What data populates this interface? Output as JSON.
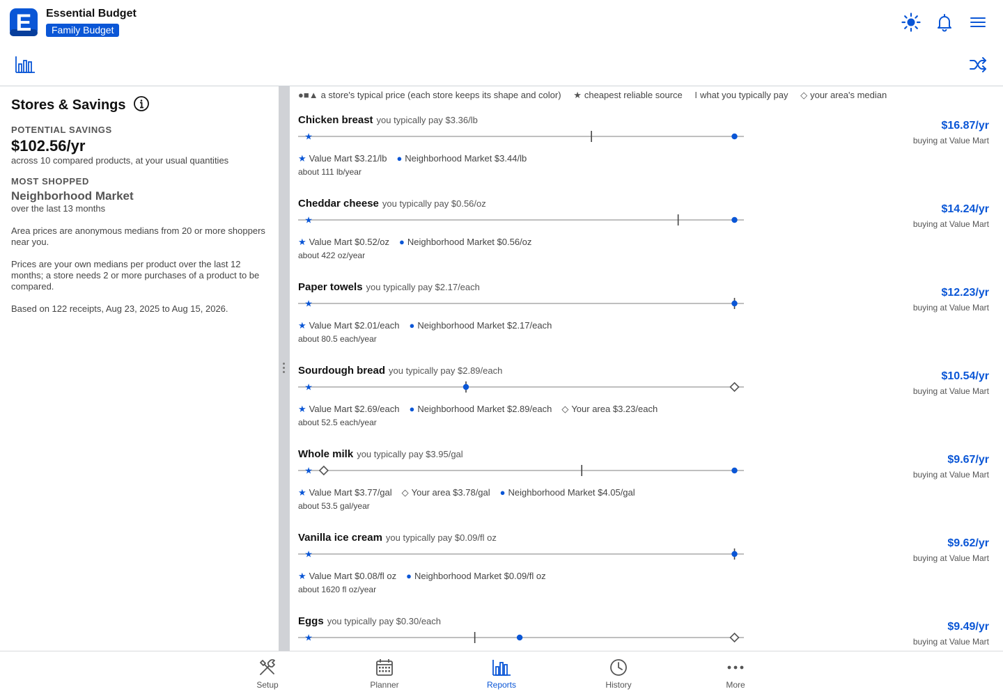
{
  "header": {
    "app_title": "Essential Budget",
    "budget_name": "Family Budget",
    "accent_color": "#0a56d6"
  },
  "left_panel": {
    "title": "Stores & Savings",
    "potential_savings_label": "POTENTIAL SAVINGS",
    "potential_savings_value": "$102.56/yr",
    "potential_savings_note": "across 10 compared products, at your usual quantities",
    "most_shopped_label": "MOST SHOPPED",
    "most_shopped_store": "Neighborhood Market",
    "most_shopped_period": "over the last 13 months",
    "note_area": "Area prices are anonymous medians from 20 or more shoppers near you.",
    "note_prices": "Prices are your own medians per product over the last 12 months; a store needs 2 or more purchases of a product to be compared.",
    "note_receipts": "Based on 122 receipts, Aug 23, 2025 to Aug 15, 2026."
  },
  "legend": {
    "store_glyphs": "●■▲",
    "store_text": "a store's typical price (each store keeps its shape and color)",
    "cheapest_glyph": "★",
    "cheapest_text": "cheapest reliable source",
    "you_glyph": "I",
    "you_text": "what you typically pay",
    "median_glyph": "◇",
    "median_text": "your area's median"
  },
  "products": [
    {
      "name": "Chicken breast",
      "you_pay": "you typically pay $3.36/lb",
      "marks": {
        "star": 0.0175,
        "you": 0.66,
        "store": 0.985
      },
      "stores": [
        {
          "glyph": "★",
          "text": "Value Mart $3.21/lb"
        },
        {
          "glyph": "●",
          "text": "Neighborhood Market $3.44/lb"
        }
      ],
      "quantity": "about 111 lb/year",
      "savings": "$16.87/yr",
      "savings_note": "buying at Value Mart"
    },
    {
      "name": "Cheddar cheese",
      "you_pay": "you typically pay $0.56/oz",
      "marks": {
        "star": 0.0175,
        "you": 0.857,
        "store": 0.985
      },
      "stores": [
        {
          "glyph": "★",
          "text": "Value Mart $0.52/oz"
        },
        {
          "glyph": "●",
          "text": "Neighborhood Market $0.56/oz"
        }
      ],
      "quantity": "about 422 oz/year",
      "savings": "$14.24/yr",
      "savings_note": "buying at Value Mart"
    },
    {
      "name": "Paper towels",
      "you_pay": "you typically pay $2.17/each",
      "marks": {
        "star": 0.0175,
        "you": 0.985,
        "store": 0.985
      },
      "stores": [
        {
          "glyph": "★",
          "text": "Value Mart $2.01/each"
        },
        {
          "glyph": "●",
          "text": "Neighborhood Market $2.17/each"
        }
      ],
      "quantity": "about 80.5 each/year",
      "savings": "$12.23/yr",
      "savings_note": "buying at Value Mart"
    },
    {
      "name": "Sourdough bread",
      "you_pay": "you typically pay $2.89/each",
      "marks": {
        "star": 0.0175,
        "you": 0.375,
        "store": 0.375,
        "median": 0.985
      },
      "stores": [
        {
          "glyph": "★",
          "text": "Value Mart $2.69/each"
        },
        {
          "glyph": "●",
          "text": "Neighborhood Market $2.89/each"
        },
        {
          "glyph": "◇",
          "text": "Your area $3.23/each"
        }
      ],
      "quantity": "about 52.5 each/year",
      "savings": "$10.54/yr",
      "savings_note": "buying at Value Mart"
    },
    {
      "name": "Whole milk",
      "you_pay": "you typically pay $3.95/gal",
      "marks": {
        "star": 0.0175,
        "median": 0.052,
        "you": 0.638,
        "store": 0.985
      },
      "stores": [
        {
          "glyph": "★",
          "text": "Value Mart $3.77/gal"
        },
        {
          "glyph": "◇",
          "text": "Your area $3.78/gal"
        },
        {
          "glyph": "●",
          "text": "Neighborhood Market $4.05/gal"
        }
      ],
      "quantity": "about 53.5 gal/year",
      "savings": "$9.67/yr",
      "savings_note": "buying at Value Mart"
    },
    {
      "name": "Vanilla ice cream",
      "you_pay": "you typically pay $0.09/fl oz",
      "marks": {
        "star": 0.0175,
        "you": 0.985,
        "store": 0.985
      },
      "stores": [
        {
          "glyph": "★",
          "text": "Value Mart $0.08/fl oz"
        },
        {
          "glyph": "●",
          "text": "Neighborhood Market $0.09/fl oz"
        }
      ],
      "quantity": "about 1620 fl oz/year",
      "savings": "$9.62/yr",
      "savings_note": "buying at Value Mart"
    },
    {
      "name": "Eggs",
      "you_pay": "you typically pay $0.30/each",
      "marks": {
        "star": 0.0175,
        "you": 0.395,
        "store": 0.497,
        "median": 0.985
      },
      "stores": [],
      "quantity": "",
      "savings": "$9.49/yr",
      "savings_note": "buying at Value Mart"
    }
  ],
  "bottom_nav": [
    {
      "label": "Setup",
      "icon": "tools-icon",
      "active": false
    },
    {
      "label": "Planner",
      "icon": "calendar-icon",
      "active": false
    },
    {
      "label": "Reports",
      "icon": "bar-chart-icon",
      "active": true
    },
    {
      "label": "History",
      "icon": "clock-icon",
      "active": false
    },
    {
      "label": "More",
      "icon": "ellipsis-icon",
      "active": false
    }
  ]
}
